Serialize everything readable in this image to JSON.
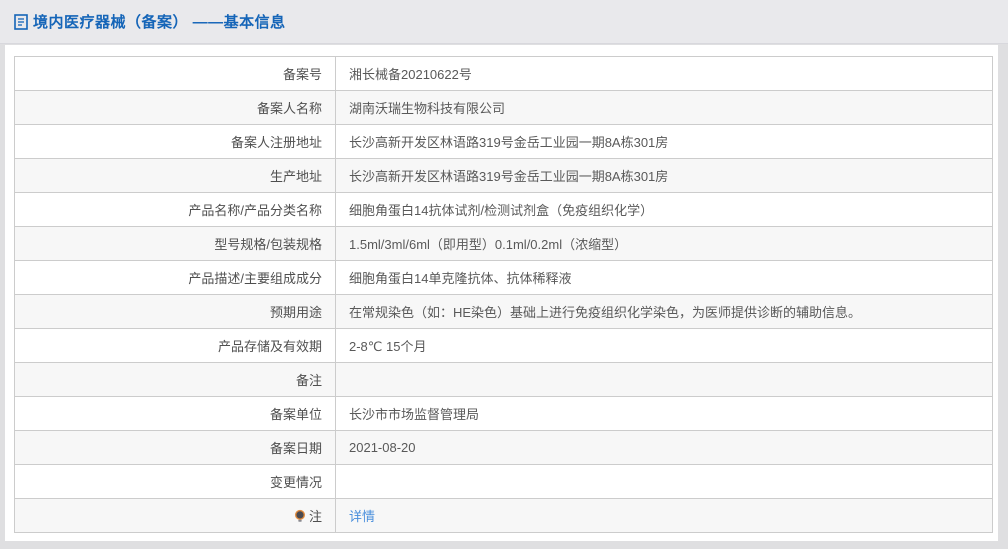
{
  "header": {
    "title": "境内医疗器械（备案） ——基本信息",
    "icon": "document-icon",
    "title_color": "#1565b8"
  },
  "colors": {
    "header_band_bg": "#e9e9ec",
    "page_bg": "#dfdfe1",
    "panel_bg": "#ffffff",
    "table_border": "#cccccc",
    "row_stripe_bg": "#f7f7f7",
    "label_text": "#4f4f4f",
    "value_text": "#595959",
    "link_blue": "#4a8fdc",
    "lightbulb_rim": "#e08a3c"
  },
  "table": {
    "rows": [
      {
        "label": "备案号",
        "value": "湘长械备20210622号"
      },
      {
        "label": "备案人名称",
        "value": "湖南沃瑞生物科技有限公司"
      },
      {
        "label": "备案人注册地址",
        "value": "长沙高新开发区林语路319号金岳工业园一期8A栋301房"
      },
      {
        "label": "生产地址",
        "value": "长沙高新开发区林语路319号金岳工业园一期8A栋301房"
      },
      {
        "label": "产品名称/产品分类名称",
        "value": "细胞角蛋白14抗体试剂/检测试剂盒（免疫组织化学）"
      },
      {
        "label": "型号规格/包装规格",
        "value": "1.5ml/3ml/6ml（即用型）0.1ml/0.2ml（浓缩型）"
      },
      {
        "label": "产品描述/主要组成成分",
        "value": "细胞角蛋白14单克隆抗体、抗体稀释液"
      },
      {
        "label": "预期用途",
        "value": "在常规染色（如：HE染色）基础上进行免疫组织化学染色，为医师提供诊断的辅助信息。"
      },
      {
        "label": "产品存储及有效期",
        "value": "2-8℃ 15个月"
      },
      {
        "label": "备注",
        "value": ""
      },
      {
        "label": "备案单位",
        "value": "长沙市市场监督管理局"
      },
      {
        "label": "备案日期",
        "value": "2021-08-20"
      },
      {
        "label": "变更情况",
        "value": ""
      },
      {
        "label": "注",
        "value": "详情",
        "label_icon": "lightbulb-icon",
        "value_is_link": true
      }
    ]
  }
}
